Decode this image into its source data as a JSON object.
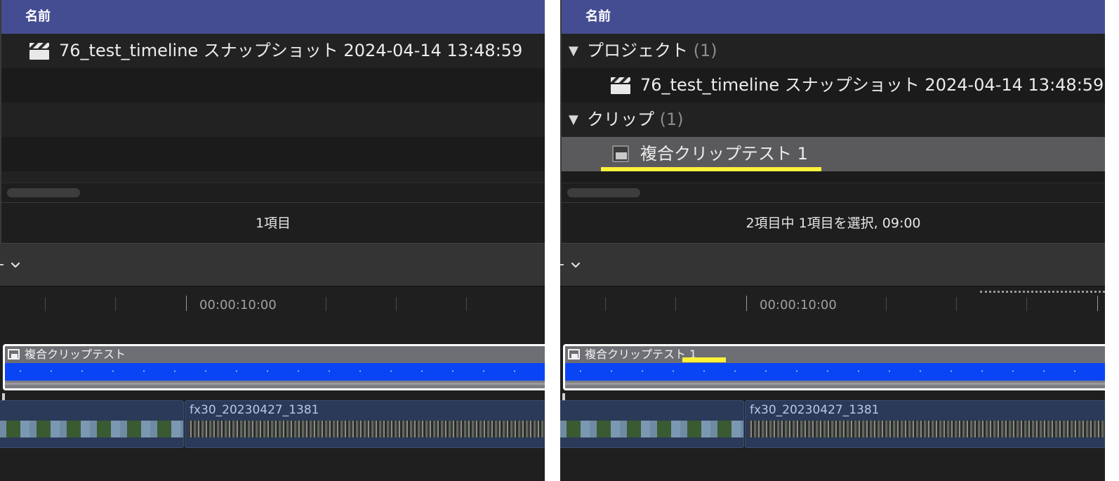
{
  "left_panel": {
    "column_header": "名前",
    "rows": [
      {
        "label": "76_test_timeline スナップショット 2024-04-14 13:48:59",
        "icon": "clapperboard-icon"
      }
    ],
    "status": "1項目",
    "timeline": {
      "timecode": "00:00:10:00",
      "compound_clip_label": "複合クリップテスト",
      "video_clip_label": "fx30_20230427_1381"
    }
  },
  "right_panel": {
    "column_header": "名前",
    "groups": [
      {
        "title": "プロジェクト",
        "count": "(1)",
        "items": [
          {
            "label": "76_test_timeline スナップショット 2024-04-14 13:48:59",
            "icon": "clapperboard-icon"
          }
        ]
      },
      {
        "title": "クリップ",
        "count": "(1)",
        "items": [
          {
            "label": "複合クリップテスト 1",
            "icon": "compound-clip-icon",
            "selected": true
          }
        ]
      }
    ],
    "status": "2項目中 1項目を選択, 09:00",
    "timeline": {
      "timecode": "00:00:10:00",
      "compound_clip_label": "複合クリップテスト 1",
      "video_clip_label": "fx30_20230427_1381"
    }
  },
  "colors": {
    "header_bg": "#454d92",
    "highlight": "#fff23a",
    "audio_blue": "#0a45f5",
    "selected_row": "#5a5a5d"
  }
}
